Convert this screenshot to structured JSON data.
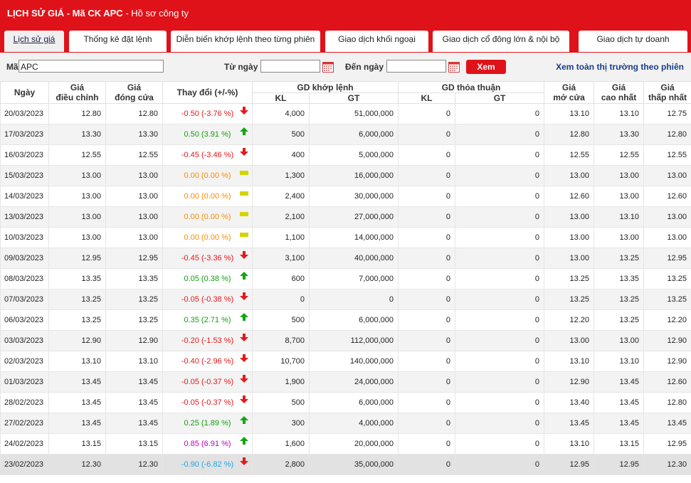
{
  "header": {
    "title_bold": "LỊCH SỬ GIÁ - Mã CK APC",
    "title_sep": " - ",
    "title_link": "Hồ sơ công ty"
  },
  "tabs": [
    {
      "label": "Lịch sử giá",
      "active": true
    },
    {
      "label": "Thống kê đặt lệnh"
    },
    {
      "label": "Diễn biến khớp lệnh theo từng phiên"
    },
    {
      "label": "Giao dịch khối ngoại"
    },
    {
      "label": "Giao dịch cổ đông lớn & nội bộ"
    },
    {
      "label": "Giao dịch tự doanh"
    }
  ],
  "toolbar": {
    "ma_label": "Mã",
    "ma_value": "APC",
    "from_label": "Từ ngày",
    "to_label": "Đến ngày",
    "xem_label": "Xem",
    "market_link": "Xem toàn thị trường theo phiên"
  },
  "columns": {
    "date": "Ngày",
    "adjusted": [
      "Giá",
      "điều chỉnh"
    ],
    "close": [
      "Giá",
      "đóng cửa"
    ],
    "change": "Thay đổi (+/-%)",
    "matched": "GD khớp lệnh",
    "negotiated": "GD thỏa thuận",
    "kl": "KL",
    "gt": "GT",
    "open": [
      "Giá",
      "mở cửa"
    ],
    "high": [
      "Giá",
      "cao nhất"
    ],
    "low": [
      "Giá",
      "thấp nhất"
    ]
  },
  "colors": {
    "brand_red": "#e01219",
    "up": "#13a10e",
    "down": "#e31a1c",
    "reference": "#ff8c00",
    "ceiling": "#c000c0",
    "floor": "#1fa8e6"
  },
  "rows": [
    {
      "date": "20/03/2023",
      "adj": "12.80",
      "close": "12.80",
      "change": "-0.50 (-3.76 %)",
      "dir": "down",
      "m_kl": "4,000",
      "m_gt": "51,000,000",
      "n_kl": "0",
      "n_gt": "0",
      "open": "13.10",
      "high": "13.10",
      "low": "12.75"
    },
    {
      "date": "17/03/2023",
      "adj": "13.30",
      "close": "13.30",
      "change": "0.50 (3.91 %)",
      "dir": "up",
      "m_kl": "500",
      "m_gt": "6,000,000",
      "n_kl": "0",
      "n_gt": "0",
      "open": "12.80",
      "high": "13.30",
      "low": "12.80"
    },
    {
      "date": "16/03/2023",
      "adj": "12.55",
      "close": "12.55",
      "change": "-0.45 (-3.46 %)",
      "dir": "down",
      "m_kl": "400",
      "m_gt": "5,000,000",
      "n_kl": "0",
      "n_gt": "0",
      "open": "12.55",
      "high": "12.55",
      "low": "12.55"
    },
    {
      "date": "15/03/2023",
      "adj": "13.00",
      "close": "13.00",
      "change": "0.00 (0.00 %)",
      "dir": "ref",
      "m_kl": "1,300",
      "m_gt": "16,000,000",
      "n_kl": "0",
      "n_gt": "0",
      "open": "13.00",
      "high": "13.00",
      "low": "13.00"
    },
    {
      "date": "14/03/2023",
      "adj": "13.00",
      "close": "13.00",
      "change": "0.00 (0.00 %)",
      "dir": "ref",
      "m_kl": "2,400",
      "m_gt": "30,000,000",
      "n_kl": "0",
      "n_gt": "0",
      "open": "12.60",
      "high": "13.00",
      "low": "12.60"
    },
    {
      "date": "13/03/2023",
      "adj": "13.00",
      "close": "13.00",
      "change": "0.00 (0.00 %)",
      "dir": "ref",
      "m_kl": "2,100",
      "m_gt": "27,000,000",
      "n_kl": "0",
      "n_gt": "0",
      "open": "13.00",
      "high": "13.10",
      "low": "13.00"
    },
    {
      "date": "10/03/2023",
      "adj": "13.00",
      "close": "13.00",
      "change": "0.00 (0.00 %)",
      "dir": "ref",
      "m_kl": "1,100",
      "m_gt": "14,000,000",
      "n_kl": "0",
      "n_gt": "0",
      "open": "13.00",
      "high": "13.00",
      "low": "13.00"
    },
    {
      "date": "09/03/2023",
      "adj": "12.95",
      "close": "12.95",
      "change": "-0.45 (-3.36 %)",
      "dir": "down",
      "m_kl": "3,100",
      "m_gt": "40,000,000",
      "n_kl": "0",
      "n_gt": "0",
      "open": "13.00",
      "high": "13.25",
      "low": "12.95"
    },
    {
      "date": "08/03/2023",
      "adj": "13.35",
      "close": "13.35",
      "change": "0.05 (0.38 %)",
      "dir": "up",
      "m_kl": "600",
      "m_gt": "7,000,000",
      "n_kl": "0",
      "n_gt": "0",
      "open": "13.25",
      "high": "13.35",
      "low": "13.25"
    },
    {
      "date": "07/03/2023",
      "adj": "13.25",
      "close": "13.25",
      "change": "-0.05 (-0.38 %)",
      "dir": "down",
      "m_kl": "0",
      "m_gt": "0",
      "n_kl": "0",
      "n_gt": "0",
      "open": "13.25",
      "high": "13.25",
      "low": "13.25"
    },
    {
      "date": "06/03/2023",
      "adj": "13.25",
      "close": "13.25",
      "change": "0.35 (2.71 %)",
      "dir": "up",
      "m_kl": "500",
      "m_gt": "6,000,000",
      "n_kl": "0",
      "n_gt": "0",
      "open": "12.20",
      "high": "13.25",
      "low": "12.20"
    },
    {
      "date": "03/03/2023",
      "adj": "12.90",
      "close": "12.90",
      "change": "-0.20 (-1.53 %)",
      "dir": "down",
      "m_kl": "8,700",
      "m_gt": "112,000,000",
      "n_kl": "0",
      "n_gt": "0",
      "open": "13.00",
      "high": "13.00",
      "low": "12.90"
    },
    {
      "date": "02/03/2023",
      "adj": "13.10",
      "close": "13.10",
      "change": "-0.40 (-2.96 %)",
      "dir": "down",
      "m_kl": "10,700",
      "m_gt": "140,000,000",
      "n_kl": "0",
      "n_gt": "0",
      "open": "13.10",
      "high": "13.10",
      "low": "12.90"
    },
    {
      "date": "01/03/2023",
      "adj": "13.45",
      "close": "13.45",
      "change": "-0.05 (-0.37 %)",
      "dir": "down",
      "m_kl": "1,900",
      "m_gt": "24,000,000",
      "n_kl": "0",
      "n_gt": "0",
      "open": "12.90",
      "high": "13.45",
      "low": "12.60"
    },
    {
      "date": "28/02/2023",
      "adj": "13.45",
      "close": "13.45",
      "change": "-0.05 (-0.37 %)",
      "dir": "down",
      "m_kl": "500",
      "m_gt": "6,000,000",
      "n_kl": "0",
      "n_gt": "0",
      "open": "13.40",
      "high": "13.45",
      "low": "12.80"
    },
    {
      "date": "27/02/2023",
      "adj": "13.45",
      "close": "13.45",
      "change": "0.25 (1.89 %)",
      "dir": "up",
      "m_kl": "300",
      "m_gt": "4,000,000",
      "n_kl": "0",
      "n_gt": "0",
      "open": "13.45",
      "high": "13.45",
      "low": "13.45"
    },
    {
      "date": "24/02/2023",
      "adj": "13.15",
      "close": "13.15",
      "change": "0.85 (6.91 %)",
      "dir": "ceil",
      "m_kl": "1,600",
      "m_gt": "20,000,000",
      "n_kl": "0",
      "n_gt": "0",
      "open": "13.10",
      "high": "13.15",
      "low": "12.95"
    },
    {
      "date": "23/02/2023",
      "adj": "12.30",
      "close": "12.30",
      "change": "-0.90 (-6.82 %)",
      "dir": "floor",
      "m_kl": "2,800",
      "m_gt": "35,000,000",
      "n_kl": "0",
      "n_gt": "0",
      "open": "12.95",
      "high": "12.95",
      "low": "12.30"
    }
  ]
}
